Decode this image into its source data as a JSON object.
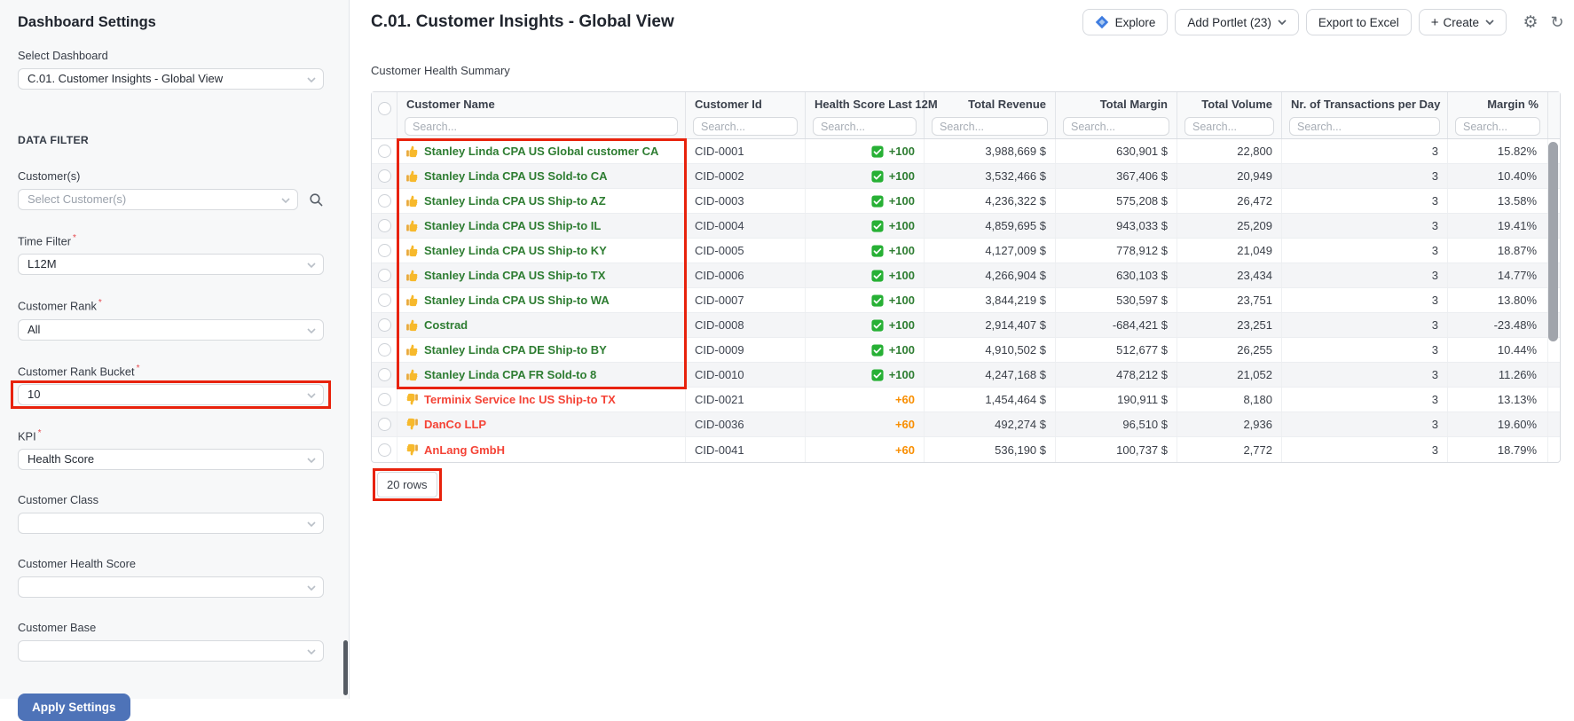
{
  "sidebar": {
    "title": "Dashboard Settings",
    "select_dashboard": {
      "label": "Select Dashboard",
      "value": "C.01. Customer Insights - Global View"
    },
    "section_header": "DATA FILTER",
    "customers_filter": {
      "label": "Customer(s)",
      "placeholder": "Select Customer(s)"
    },
    "fields": [
      {
        "label": "Time Filter",
        "value": "L12M",
        "required": true
      },
      {
        "label": "Customer Rank",
        "value": "All",
        "required": true
      },
      {
        "label": "Customer Rank Bucket",
        "value": "10",
        "required": true,
        "highlighted": true
      },
      {
        "label": "KPI",
        "value": "Health Score",
        "required": true
      },
      {
        "label": "Customer Class",
        "value": ""
      },
      {
        "label": "Customer Health Score",
        "value": ""
      },
      {
        "label": "Customer Base",
        "value": ""
      }
    ],
    "apply_button_label": "Apply Settings"
  },
  "header": {
    "title": "C.01. Customer Insights - Global View",
    "buttons": {
      "explore": "Explore",
      "add_portlet": "Add Portlet (23)",
      "export_excel": "Export to Excel",
      "create": "Create"
    }
  },
  "portlet": {
    "title": "Customer Health Summary",
    "search_placeholder": "Search...",
    "columns": [
      "Customer Name",
      "Customer Id",
      "Health Score Last 12M",
      "Total Revenue",
      "Total Margin",
      "Total Volume",
      "Nr. of Transactions per Day",
      "Margin %"
    ],
    "rows": [
      {
        "name": "Stanley Linda CPA US Global customer CA",
        "trend": "up",
        "id": "CID-0001",
        "health": "+100",
        "has_check": true,
        "revenue": "3,988,669 $",
        "margin": "630,901 $",
        "volume": "22,800",
        "transactions": "3",
        "margin_pct": "15.82%"
      },
      {
        "name": "Stanley Linda CPA US Sold-to CA",
        "trend": "up",
        "id": "CID-0002",
        "health": "+100",
        "has_check": true,
        "revenue": "3,532,466 $",
        "margin": "367,406 $",
        "volume": "20,949",
        "transactions": "3",
        "margin_pct": "10.40%"
      },
      {
        "name": "Stanley Linda CPA US Ship-to AZ",
        "trend": "up",
        "id": "CID-0003",
        "health": "+100",
        "has_check": true,
        "revenue": "4,236,322 $",
        "margin": "575,208 $",
        "volume": "26,472",
        "transactions": "3",
        "margin_pct": "13.58%"
      },
      {
        "name": "Stanley Linda CPA US Ship-to IL",
        "trend": "up",
        "id": "CID-0004",
        "health": "+100",
        "has_check": true,
        "revenue": "4,859,695 $",
        "margin": "943,033 $",
        "volume": "25,209",
        "transactions": "3",
        "margin_pct": "19.41%"
      },
      {
        "name": "Stanley Linda CPA US Ship-to KY",
        "trend": "up",
        "id": "CID-0005",
        "health": "+100",
        "has_check": true,
        "revenue": "4,127,009 $",
        "margin": "778,912 $",
        "volume": "21,049",
        "transactions": "3",
        "margin_pct": "18.87%"
      },
      {
        "name": "Stanley Linda CPA US Ship-to TX",
        "trend": "up",
        "id": "CID-0006",
        "health": "+100",
        "has_check": true,
        "revenue": "4,266,904 $",
        "margin": "630,103 $",
        "volume": "23,434",
        "transactions": "3",
        "margin_pct": "14.77%"
      },
      {
        "name": "Stanley Linda CPA US Ship-to WA",
        "trend": "up",
        "id": "CID-0007",
        "health": "+100",
        "has_check": true,
        "revenue": "3,844,219 $",
        "margin": "530,597 $",
        "volume": "23,751",
        "transactions": "3",
        "margin_pct": "13.80%"
      },
      {
        "name": "Costrad",
        "trend": "up",
        "id": "CID-0008",
        "health": "+100",
        "has_check": true,
        "revenue": "2,914,407 $",
        "margin": "-684,421 $",
        "volume": "23,251",
        "transactions": "3",
        "margin_pct": "-23.48%"
      },
      {
        "name": "Stanley Linda CPA DE Ship-to BY",
        "trend": "up",
        "id": "CID-0009",
        "health": "+100",
        "has_check": true,
        "revenue": "4,910,502 $",
        "margin": "512,677 $",
        "volume": "26,255",
        "transactions": "3",
        "margin_pct": "10.44%"
      },
      {
        "name": "Stanley Linda CPA FR Sold-to 8",
        "trend": "up",
        "id": "CID-0010",
        "health": "+100",
        "has_check": true,
        "revenue": "4,247,168 $",
        "margin": "478,212 $",
        "volume": "21,052",
        "transactions": "3",
        "margin_pct": "11.26%"
      },
      {
        "name": "Terminix Service Inc US Ship-to TX",
        "trend": "down",
        "id": "CID-0021",
        "health": "+60",
        "has_check": false,
        "revenue": "1,454,464 $",
        "margin": "190,911 $",
        "volume": "8,180",
        "transactions": "3",
        "margin_pct": "13.13%"
      },
      {
        "name": "DanCo LLP",
        "trend": "down",
        "id": "CID-0036",
        "health": "+60",
        "has_check": false,
        "revenue": "492,274 $",
        "margin": "96,510 $",
        "volume": "2,936",
        "transactions": "3",
        "margin_pct": "19.60%"
      },
      {
        "name": "AnLang GmbH",
        "trend": "down",
        "id": "CID-0041",
        "health": "+60",
        "has_check": false,
        "revenue": "536,190 $",
        "margin": "100,737 $",
        "volume": "2,772",
        "transactions": "3",
        "margin_pct": "18.79%"
      }
    ],
    "footer_label": "20 rows"
  },
  "colors": {
    "annotation_red": "#e8220c",
    "positive_green": "#2e7d32",
    "negative_red": "#f44336",
    "warning_orange": "#f98e00",
    "apply_button_blue": "#4e73b8",
    "explore_icon_blue": "#3e7ce0",
    "health_check_green": "#27b035"
  }
}
